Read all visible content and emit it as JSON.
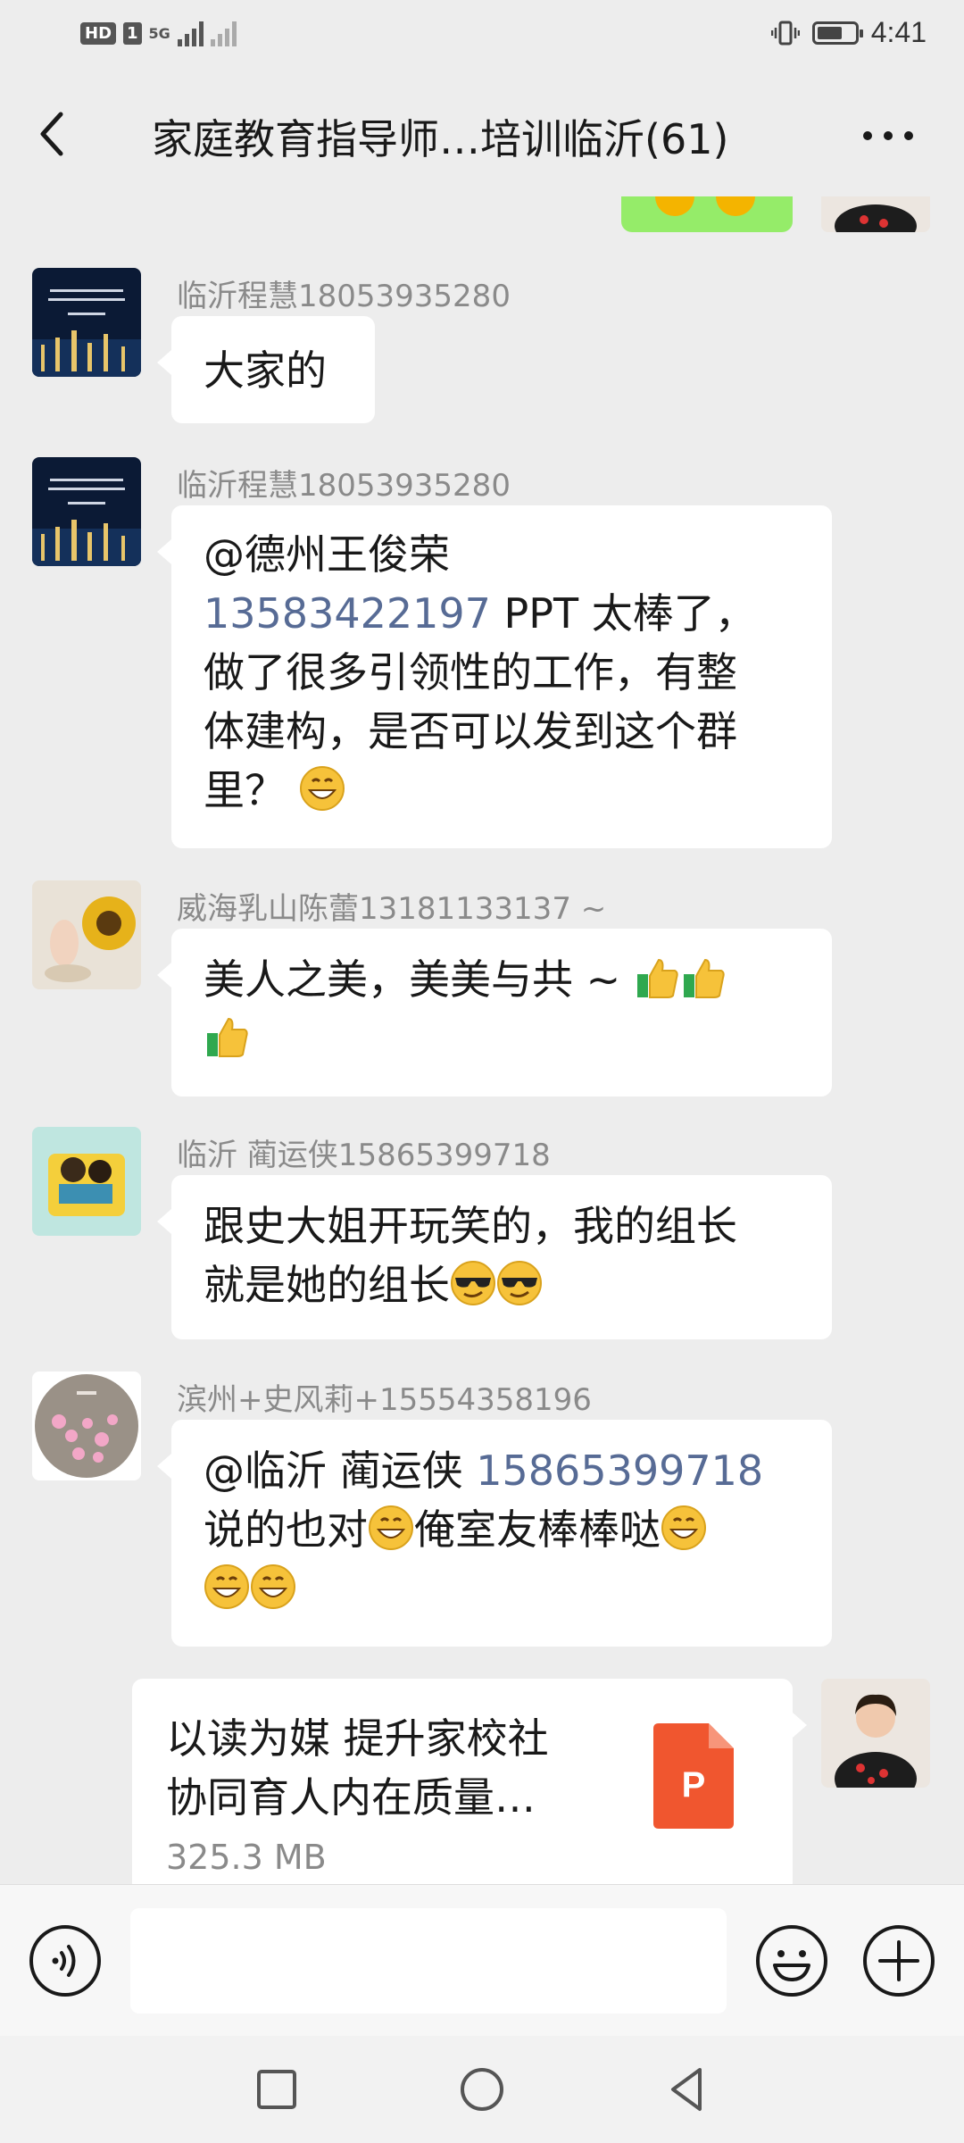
{
  "status_bar": {
    "hd": "HD",
    "sim": "1",
    "network": "5G",
    "time": "4:41"
  },
  "header": {
    "title": "家庭教育指导师…培训临沂(61)"
  },
  "messages": [
    {
      "sender": "临沂程慧18053935280",
      "text": "大家的"
    },
    {
      "sender": "临沂程慧18053935280",
      "mention": "@德州王俊荣",
      "mention_phone": "13583422197",
      "text_line1": " PPT 太棒了，",
      "text_line2": "做了很多引领性的工作，有整",
      "text_line3": "体建构，是否可以发到这个群",
      "text_line4": "里？"
    },
    {
      "sender": "威海乳山陈蕾13181133137 ~",
      "text": "美人之美，美美与共 ~ "
    },
    {
      "sender": "临沂 蔺运侠15865399718",
      "text_line1": "跟史大姐开玩笑的，我的组长",
      "text_line2": "就是她的组长"
    },
    {
      "sender": "滨州+史风莉+15554358196",
      "mention": "@临沂 蔺运侠",
      "mention_phone": "15865399718",
      "text_line2": "说的也对",
      "text_line2b": "俺室友棒棒哒"
    }
  ],
  "file": {
    "name_line1": "以读为媒 提升家校社",
    "name_line2": "协同育人内在质量…",
    "size": "325.3 MB",
    "icon_letter": "P"
  },
  "colors": {
    "background": "#ededed",
    "bubble": "#ffffff",
    "self_bubble": "#95ec69",
    "mention": "#576b95",
    "ppt_icon": "#f0562f"
  }
}
